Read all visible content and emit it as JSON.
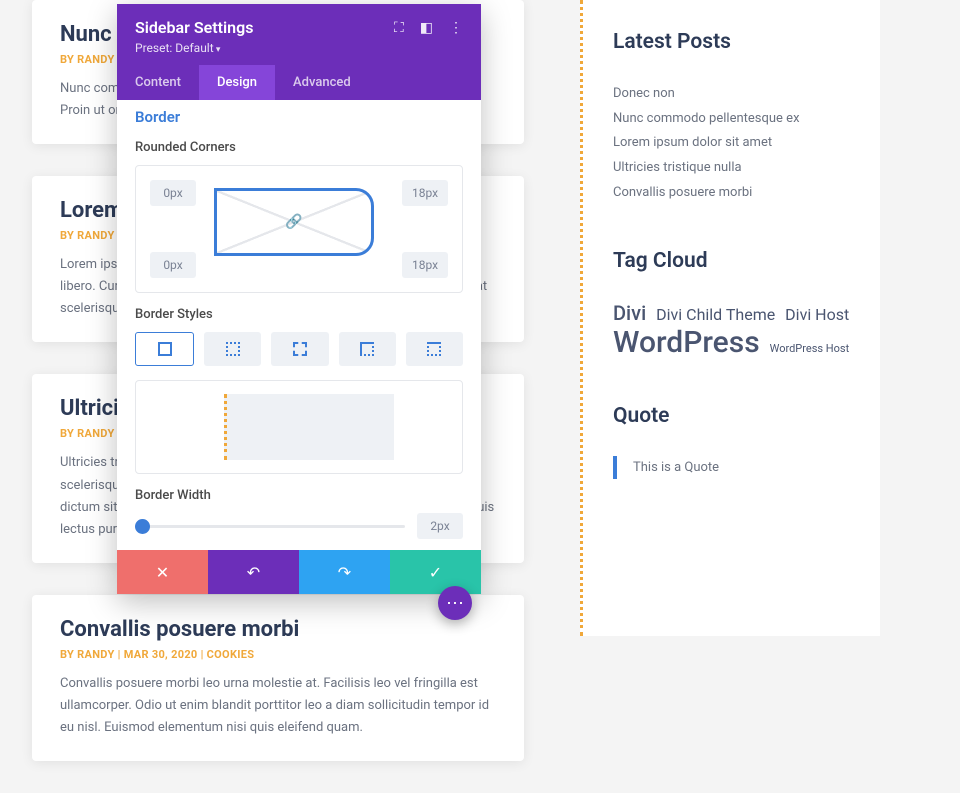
{
  "articles": [
    {
      "title": "Nunc commodo",
      "meta": "BY RANDY | JAN 14, 2020",
      "body": "Nunc commodo pellentesque ex, non aliquam lectus tempor venenatis. Proin ut orci commodo, ac hendrerit consequat."
    },
    {
      "title": "Lorem ipsum dolor sit amet",
      "meta": "BY RANDY | JAN 14, 2020",
      "body": "Lorem ipsum dolor sit amet, consectetur adipiscing elit. Aenean ut mollis libero. Curabitur ac cursus quam, sit amet elementum orci. Donec volutpat scelerisque porta amet felis leo, ac pretium."
    },
    {
      "title": "Ultricies tristique nulla",
      "meta": "BY RANDY | APR 14, 2020",
      "body": "Ultricies tristique nulla aliquet enim tortor at. Metus vulputate eu scelerisque felis imperdiet proin. Justo laoreet sit amet cursus sit amet dictum sit amet. Integer enim neque volutpat ac tincidunt vitae semper quis lectus purus sit. Pellentesque."
    },
    {
      "title": "Convallis posuere morbi",
      "meta": "BY RANDY | MAR 30, 2020 | COOKIES",
      "body": "Convallis posuere morbi leo urna molestie at. Facilisis leo vel fringilla est ullamcorper. Odio ut enim blandit porttitor leo a diam sollicitudin tempor id eu nisl. Euismod elementum nisi quis eleifend quam."
    }
  ],
  "sidebar": {
    "latest_title": "Latest Posts",
    "posts": [
      "Donec non",
      "Nunc commodo pellentesque ex",
      "Lorem ipsum dolor sit amet",
      "Ultricies tristique nulla",
      "Convallis posuere morbi"
    ],
    "tagcloud_title": "Tag Cloud",
    "tags": {
      "divi": "Divi",
      "child": "Divi Child Theme",
      "host": "Divi Host",
      "wp": "WordPress",
      "wphost": "WordPress Host"
    },
    "quote_title": "Quote",
    "quote_text": "This is a Quote"
  },
  "panel": {
    "title": "Sidebar Settings",
    "preset": "Preset: Default",
    "tabs": {
      "content": "Content",
      "design": "Design",
      "advanced": "Advanced"
    },
    "section": "Border",
    "labels": {
      "rounded": "Rounded Corners",
      "styles": "Border Styles",
      "width": "Border Width"
    },
    "corners": {
      "tl": "0px",
      "tr": "18px",
      "bl": "0px",
      "br": "18px"
    },
    "width_value": "2px"
  }
}
